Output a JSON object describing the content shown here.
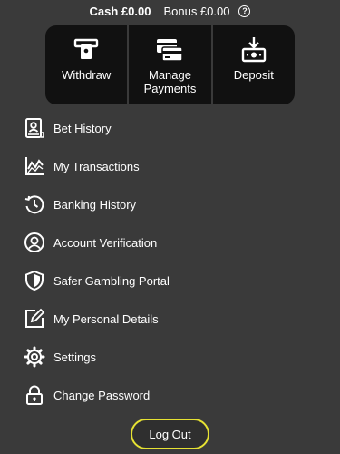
{
  "balance": {
    "cash_label": "Cash £0.00",
    "bonus_label": "Bonus £0.00",
    "help_glyph": "?"
  },
  "actions": [
    {
      "label": "Withdraw",
      "icon": "atm-icon"
    },
    {
      "label": "Manage\nPayments",
      "icon": "card-icon"
    },
    {
      "label": "Deposit",
      "icon": "deposit-icon"
    }
  ],
  "menu": [
    {
      "label": "Bet History",
      "icon": "receipt-icon"
    },
    {
      "label": "My Transactions",
      "icon": "chart-line-icon"
    },
    {
      "label": "Banking History",
      "icon": "history-clock-icon"
    },
    {
      "label": "Account Verification",
      "icon": "user-verify-icon"
    },
    {
      "label": "Safer Gambling Portal",
      "icon": "shield-icon"
    },
    {
      "label": "My Personal Details",
      "icon": "edit-icon"
    },
    {
      "label": "Settings",
      "icon": "gear-icon"
    },
    {
      "label": "Change Password",
      "icon": "lock-icon"
    }
  ],
  "logout_label": "Log Out",
  "colors": {
    "background": "#3a3a3a",
    "action_panel": "#111111",
    "logout_border": "#e6e233",
    "text": "#ffffff"
  }
}
